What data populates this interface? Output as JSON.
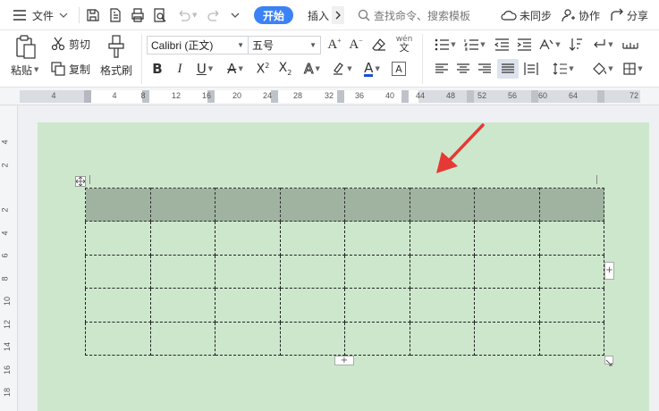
{
  "topbar": {
    "file_label": "文件",
    "active_tab": "开始",
    "next_tab": "插入",
    "search_placeholder": "查找命令、搜索模板",
    "sync_label": "未同步",
    "collab_label": "协作",
    "share_label": "分享"
  },
  "ribbon": {
    "paste_label": "粘贴",
    "cut_label": "剪切",
    "copy_label": "复制",
    "format_painter_label": "格式刷",
    "font_name": "Calibri (正文)",
    "font_size": "五号",
    "phonetic_label": "wén"
  },
  "ruler": {
    "ticks": [
      "4",
      "4",
      "8",
      "12",
      "16",
      "20",
      "24",
      "28",
      "32",
      "36",
      "40",
      "44",
      "48",
      "52",
      "56",
      "60",
      "64",
      "72"
    ]
  },
  "vruler": {
    "ticks": [
      "4",
      "2",
      "2",
      "4",
      "6",
      "8",
      "10",
      "12",
      "14",
      "16",
      "18"
    ]
  },
  "table": {
    "columns": 8,
    "rows": 5
  },
  "colors": {
    "accent": "#3b82f6",
    "page_bg": "#cde7cc",
    "header_fill": "#9fb3a0",
    "arrow": "#e53935"
  }
}
